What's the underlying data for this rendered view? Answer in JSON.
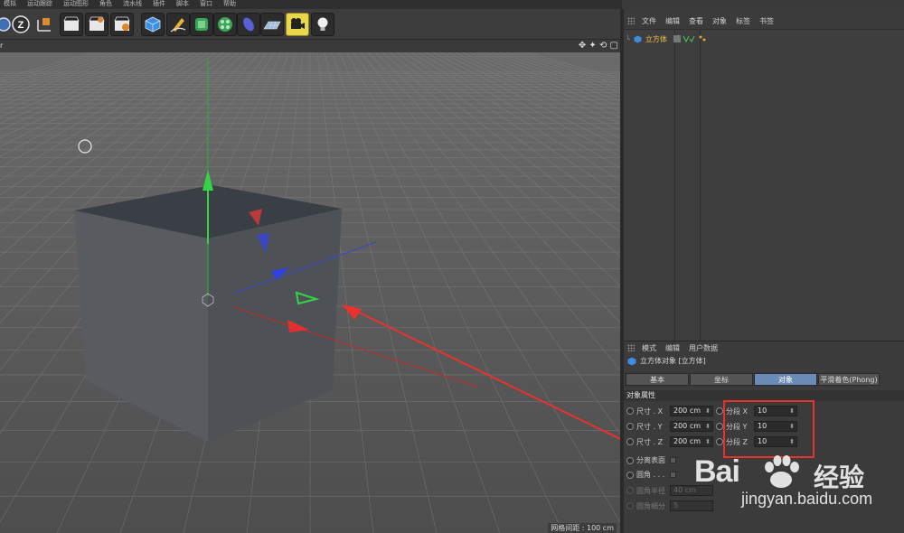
{
  "menubar": [
    "模拟",
    "运动跟踪",
    "运动图形",
    "角色",
    "流水线",
    "插件",
    "脚本",
    "窗口",
    "帮助"
  ],
  "toolbar": {
    "icons": [
      "undo-icon",
      "zoom-icon",
      "axis-icon",
      "render-view-icon",
      "render-picture-icon",
      "render-settings-icon",
      "cube-icon",
      "pen-icon",
      "subdivision-icon",
      "array-icon",
      "deformer-icon",
      "floor-icon",
      "camera-icon",
      "light-icon"
    ]
  },
  "viewport": {
    "nav_glyphs": "✥ ✦ ⟲ ▢",
    "grid_label": "网格间距 : 100 cm",
    "view_label": "r"
  },
  "object_manager": {
    "menu": [
      "文件",
      "编辑",
      "查看",
      "对象",
      "标签",
      "书签"
    ],
    "object_name": "立方体"
  },
  "attributes": {
    "menu": [
      "模式",
      "编辑",
      "用户数据"
    ],
    "title": "立方体对象 [立方体]",
    "tabs": [
      "基本",
      "坐标",
      "对象",
      "平滑着色(Phong)"
    ],
    "active_tab": "对象",
    "section": "对象属性",
    "size_rows": [
      {
        "label": "尺寸 . X",
        "value": "200 cm"
      },
      {
        "label": "尺寸 . Y",
        "value": "200 cm"
      },
      {
        "label": "尺寸 . Z",
        "value": "200 cm"
      }
    ],
    "seg_rows": [
      {
        "label": "分段 X",
        "value": "10"
      },
      {
        "label": "分段 Y",
        "value": "10"
      },
      {
        "label": "分段 Z",
        "value": "10"
      }
    ],
    "separate_surfaces": "分离表面",
    "fillet": "圆角 . . .",
    "fillet_radius": {
      "label": "圆角半径",
      "value": "40 cm"
    },
    "fillet_subdiv": {
      "label": "圆角细分",
      "value": "5"
    }
  },
  "watermark": {
    "brand": "Bai",
    "brand2": "经验",
    "url": "jingyan.baidu.com"
  },
  "colors": {
    "cube_front": "#55595f",
    "cube_top": "#3a3f45",
    "highlight": "#e8322e",
    "active_tab": "#6a8bb6",
    "object_name": "#f1c24a"
  }
}
